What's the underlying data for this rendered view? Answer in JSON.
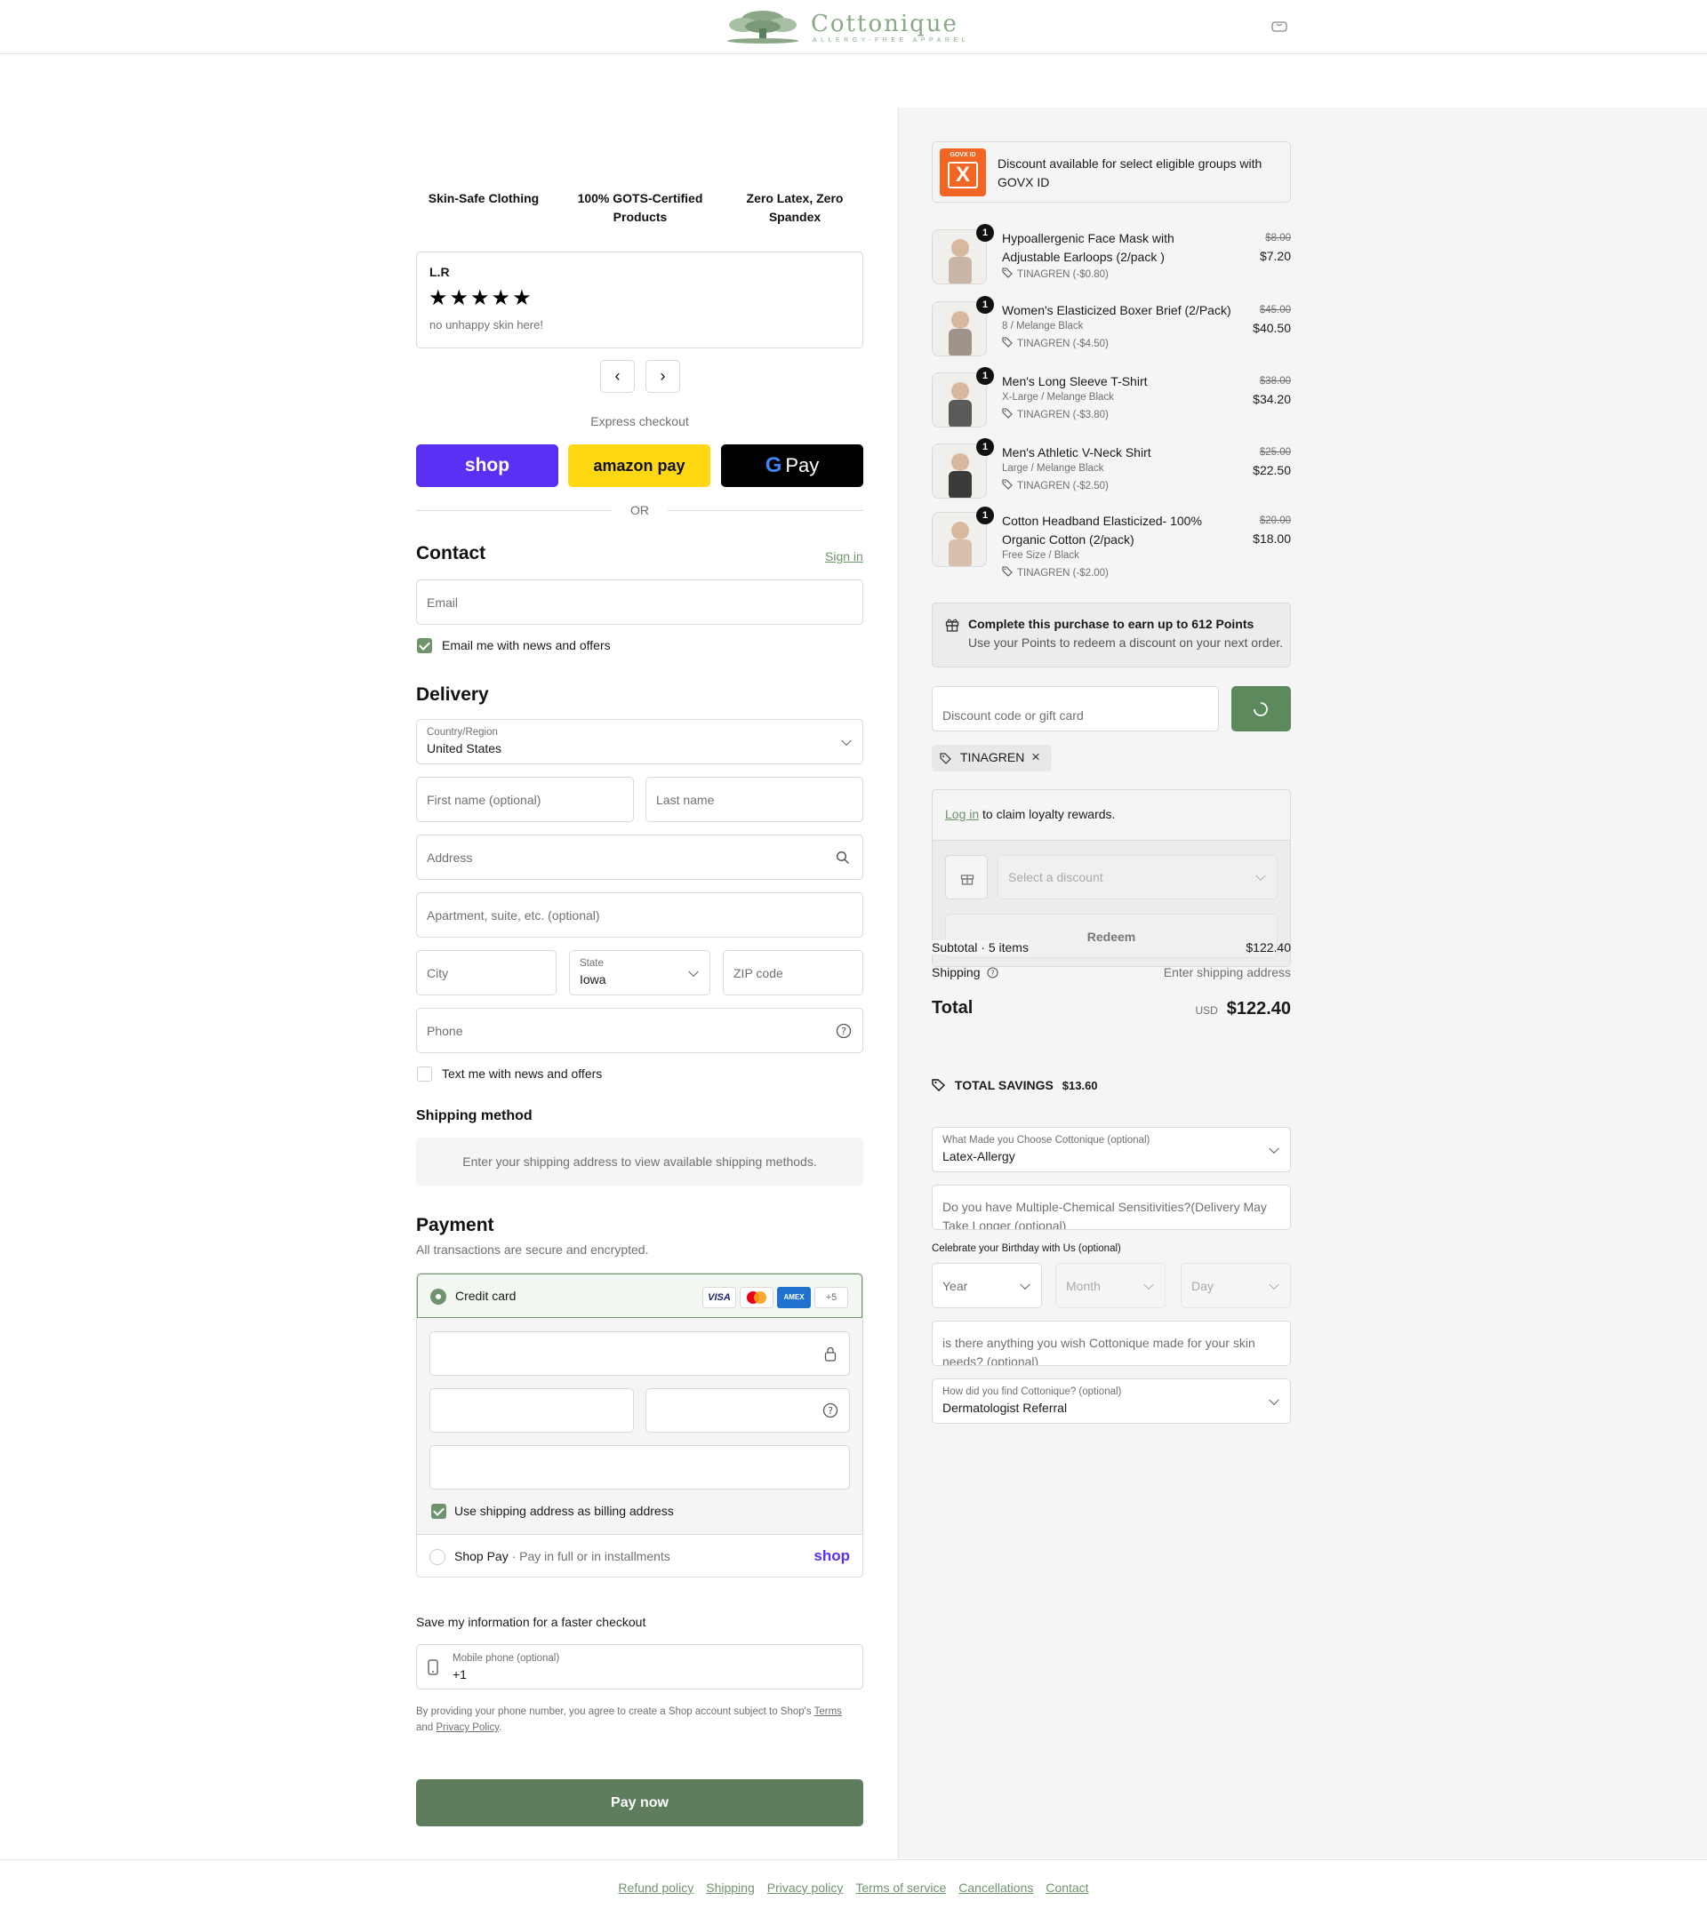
{
  "brand": {
    "name": "Cottonique",
    "tagline": "ALLERGY-FREE APPAREL",
    "accent": "#6f946d"
  },
  "badges": [
    "Skin-Safe Clothing",
    "100% GOTS-Certified Products",
    "Zero Latex, Zero Spandex"
  ],
  "review": {
    "author": "L.R",
    "stars": 5,
    "text": "no unhappy skin here!"
  },
  "express": {
    "label": "Express checkout",
    "shop": "shop",
    "amazon": "amazon pay",
    "gpay": "Pay",
    "or": "OR"
  },
  "contact": {
    "title": "Contact",
    "sign_in": "Sign in",
    "email_placeholder": "Email",
    "news_label": "Email me with news and offers"
  },
  "delivery": {
    "title": "Delivery",
    "country_label": "Country/Region",
    "country_value": "United States",
    "first_name": "First name (optional)",
    "last_name": "Last name",
    "address": "Address",
    "apartment": "Apartment, suite, etc. (optional)",
    "city": "City",
    "state_label": "State",
    "state_value": "Iowa",
    "zip": "ZIP code",
    "phone": "Phone",
    "text_label": "Text me with news and offers"
  },
  "shipping_method": {
    "title": "Shipping method",
    "message": "Enter your shipping address to view available shipping methods."
  },
  "payment": {
    "title": "Payment",
    "subtitle": "All transactions are secure and encrypted.",
    "credit_card": "Credit card",
    "more_cards": "+5",
    "billing_label": "Use shipping address as billing address",
    "shop_pay": "Shop Pay",
    "shop_pay_sub": "Pay in full or in installments",
    "shop_logo": "shop"
  },
  "save_info": {
    "title": "Save my information for a faster checkout",
    "mobile_label": "Mobile phone (optional)",
    "mobile_value": "+1",
    "legal_1": "By providing your phone number, you agree to create a Shop account subject to Shop's",
    "terms": "Terms",
    "and": "and",
    "privacy": "Privacy Policy"
  },
  "pay_now": "Pay now",
  "govx": {
    "logo": "GOVX ID",
    "text": "Discount available for select eligible groups with GOVX ID"
  },
  "items": [
    {
      "qty": "1",
      "name": "Hypoallergenic Face Mask with Adjustable Earloops (2/pack )",
      "variant": "",
      "discount": "TINAGREN (-$0.80)",
      "old": "$8.00",
      "price": "$7.20"
    },
    {
      "qty": "1",
      "name": "Women's Elasticized Boxer Brief (2/Pack)",
      "variant": "8 / Melange Black",
      "discount": "TINAGREN (-$4.50)",
      "old": "$45.00",
      "price": "$40.50"
    },
    {
      "qty": "1",
      "name": "Men's Long Sleeve T-Shirt",
      "variant": "X-Large / Melange Black",
      "discount": "TINAGREN (-$3.80)",
      "old": "$38.00",
      "price": "$34.20"
    },
    {
      "qty": "1",
      "name": "Men's Athletic V-Neck Shirt",
      "variant": "Large / Melange Black",
      "discount": "TINAGREN (-$2.50)",
      "old": "$25.00",
      "price": "$22.50"
    },
    {
      "qty": "1",
      "name": "Cotton Headband Elasticized- 100% Organic Cotton (2/pack)",
      "variant": "Free Size / Black",
      "discount": "TINAGREN (-$2.00)",
      "old": "$20.00",
      "price": "$18.00"
    }
  ],
  "points": {
    "title": "Complete this purchase to earn up to 612 Points",
    "sub": "Use your Points to redeem a discount on your next order."
  },
  "discount": {
    "placeholder": "Discount code or gift card",
    "applied": "TINAGREN"
  },
  "loyalty": {
    "login": "Log in",
    "text": "to claim loyalty rewards.",
    "select": "Select a discount",
    "redeem": "Redeem"
  },
  "summary": {
    "subtotal_label": "Subtotal · 5 items",
    "subtotal": "$122.40",
    "shipping_label": "Shipping",
    "shipping_value": "Enter shipping address",
    "total_label": "Total",
    "currency": "USD",
    "total": "$122.40",
    "savings_label": "TOTAL SAVINGS",
    "savings": "$13.60"
  },
  "extra": {
    "why_label": "What Made you Choose Cottonique (optional)",
    "why_value": "Latex-Allergy",
    "mcs": "Do you have Multiple-Chemical Sensitivities?(Delivery May Take Longer (optional)",
    "birthday": "Celebrate your Birthday with Us (optional)",
    "year": "Year",
    "month": "Month",
    "day": "Day",
    "wish": "is there anything you wish Cottonique made for your skin needs? (optional)",
    "find_label": "How did you find Cottonique? (optional)",
    "find_value": "Dermatologist Referral"
  },
  "footer": [
    "Refund policy",
    "Shipping",
    "Privacy policy",
    "Terms of service",
    "Cancellations",
    "Contact"
  ]
}
